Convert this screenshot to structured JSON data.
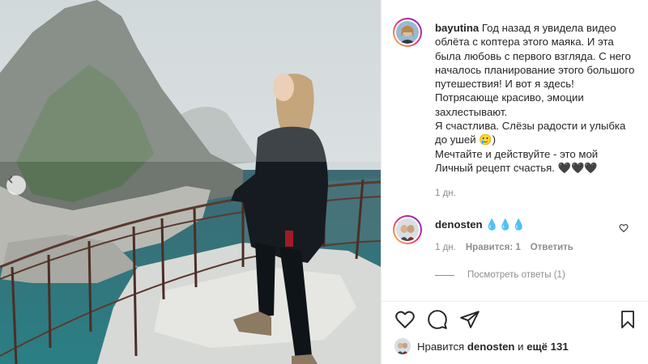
{
  "post": {
    "author": "bayutina",
    "caption": "Год назад я увидела видео облёта с коптера этого маяка. И эта была любовь с первого взгляда. С него началось планирование этого большого путешествия! И вот я здесь! Потрясающе красиво, эмоции захлестывают.\nЯ счастлива. Слёзы радости и улыбка до ушей 🥲)\nМечтайте и действуйте - это мой Личный рецепт счастья. 🖤🖤🖤",
    "time": "1 дн."
  },
  "comment": {
    "author": "denosten",
    "text": "💧💧💧",
    "time": "1 дн.",
    "likes_label": "Нравится: 1",
    "reply_label": "Ответить",
    "view_replies_label": "Посмотреть ответы (1)"
  },
  "likes": {
    "prefix": "Нравится",
    "user": "denosten",
    "middle": "и",
    "others": "ещё 131"
  },
  "icons": {
    "prev": "chevron-left-icon",
    "like": "heart-icon",
    "comment": "speech-bubble-icon",
    "share": "paper-plane-icon",
    "save": "bookmark-icon"
  },
  "colors": {
    "text": "#262626",
    "secondary": "#8e8e8e",
    "divider": "#efefef"
  }
}
